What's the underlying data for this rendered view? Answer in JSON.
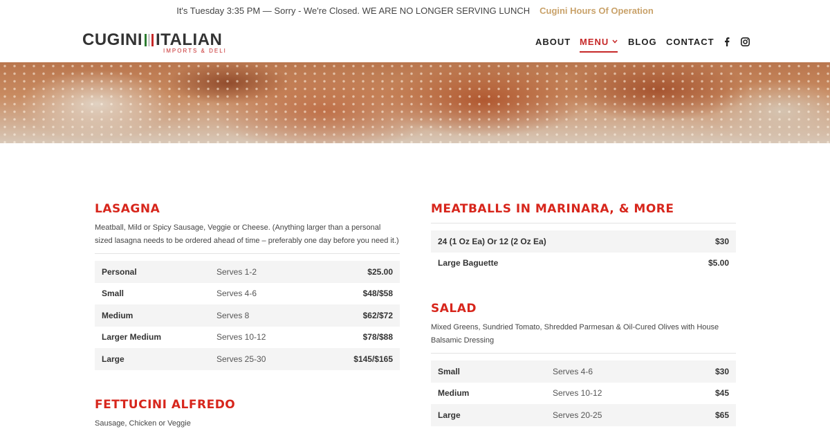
{
  "topbar": {
    "notice": "It's Tuesday 3:35 PM — Sorry - We're Closed. WE ARE NO LONGER SERVING LUNCH",
    "hours_link": "Cugini Hours Of Operation"
  },
  "logo": {
    "part1": "CUGINI",
    "part2": "ITALIAN",
    "sub": "IMPORTS & DELI",
    "flag_colors": [
      "#2e7d32",
      "#ffffff",
      "#c62828"
    ]
  },
  "nav": {
    "about": "ABOUT",
    "menu": "MENU",
    "blog": "BLOG",
    "contact": "CONTACT"
  },
  "social": [
    "facebook-icon",
    "instagram-icon"
  ],
  "accent": "#d7261c",
  "lasagna": {
    "title": "LASAGNA",
    "desc": "Meatball, Mild or Spicy Sausage, Veggie or Cheese. (Anything larger than a personal sized lasagna needs to be ordered ahead of time – preferably one day before you need it.)",
    "rows": [
      {
        "size": "Personal",
        "serves": "Serves 1-2",
        "price": "$25.00"
      },
      {
        "size": "Small",
        "serves": "Serves 4-6",
        "price": "$48/$58"
      },
      {
        "size": "Medium",
        "serves": "Serves 8",
        "price": "$62/$72"
      },
      {
        "size": "Larger Medium",
        "serves": "Serves 10-12",
        "price": "$78/$88"
      },
      {
        "size": "Large",
        "serves": "Serves 25-30",
        "price": "$145/$165"
      }
    ]
  },
  "fettucini": {
    "title": "FETTUCINI ALFREDO",
    "desc": "Sausage, Chicken or Veggie"
  },
  "meatballs": {
    "title": "MEATBALLS IN MARINARA, & MORE",
    "rows": [
      {
        "size": "24 (1 Oz Ea) Or 12 (2 Oz Ea)",
        "price": "$30"
      },
      {
        "size": "Large Baguette",
        "price": "$5.00"
      }
    ]
  },
  "salad": {
    "title": "SALAD",
    "desc": "Mixed Greens, Sundried Tomato, Shredded Parmesan & Oil-Cured Olives with House Balsamic Dressing",
    "rows": [
      {
        "size": "Small",
        "serves": "Serves 4-6",
        "price": "$30"
      },
      {
        "size": "Medium",
        "serves": "Serves 10-12",
        "price": "$45"
      },
      {
        "size": "Large",
        "serves": "Serves 20-25",
        "price": "$65"
      }
    ]
  }
}
